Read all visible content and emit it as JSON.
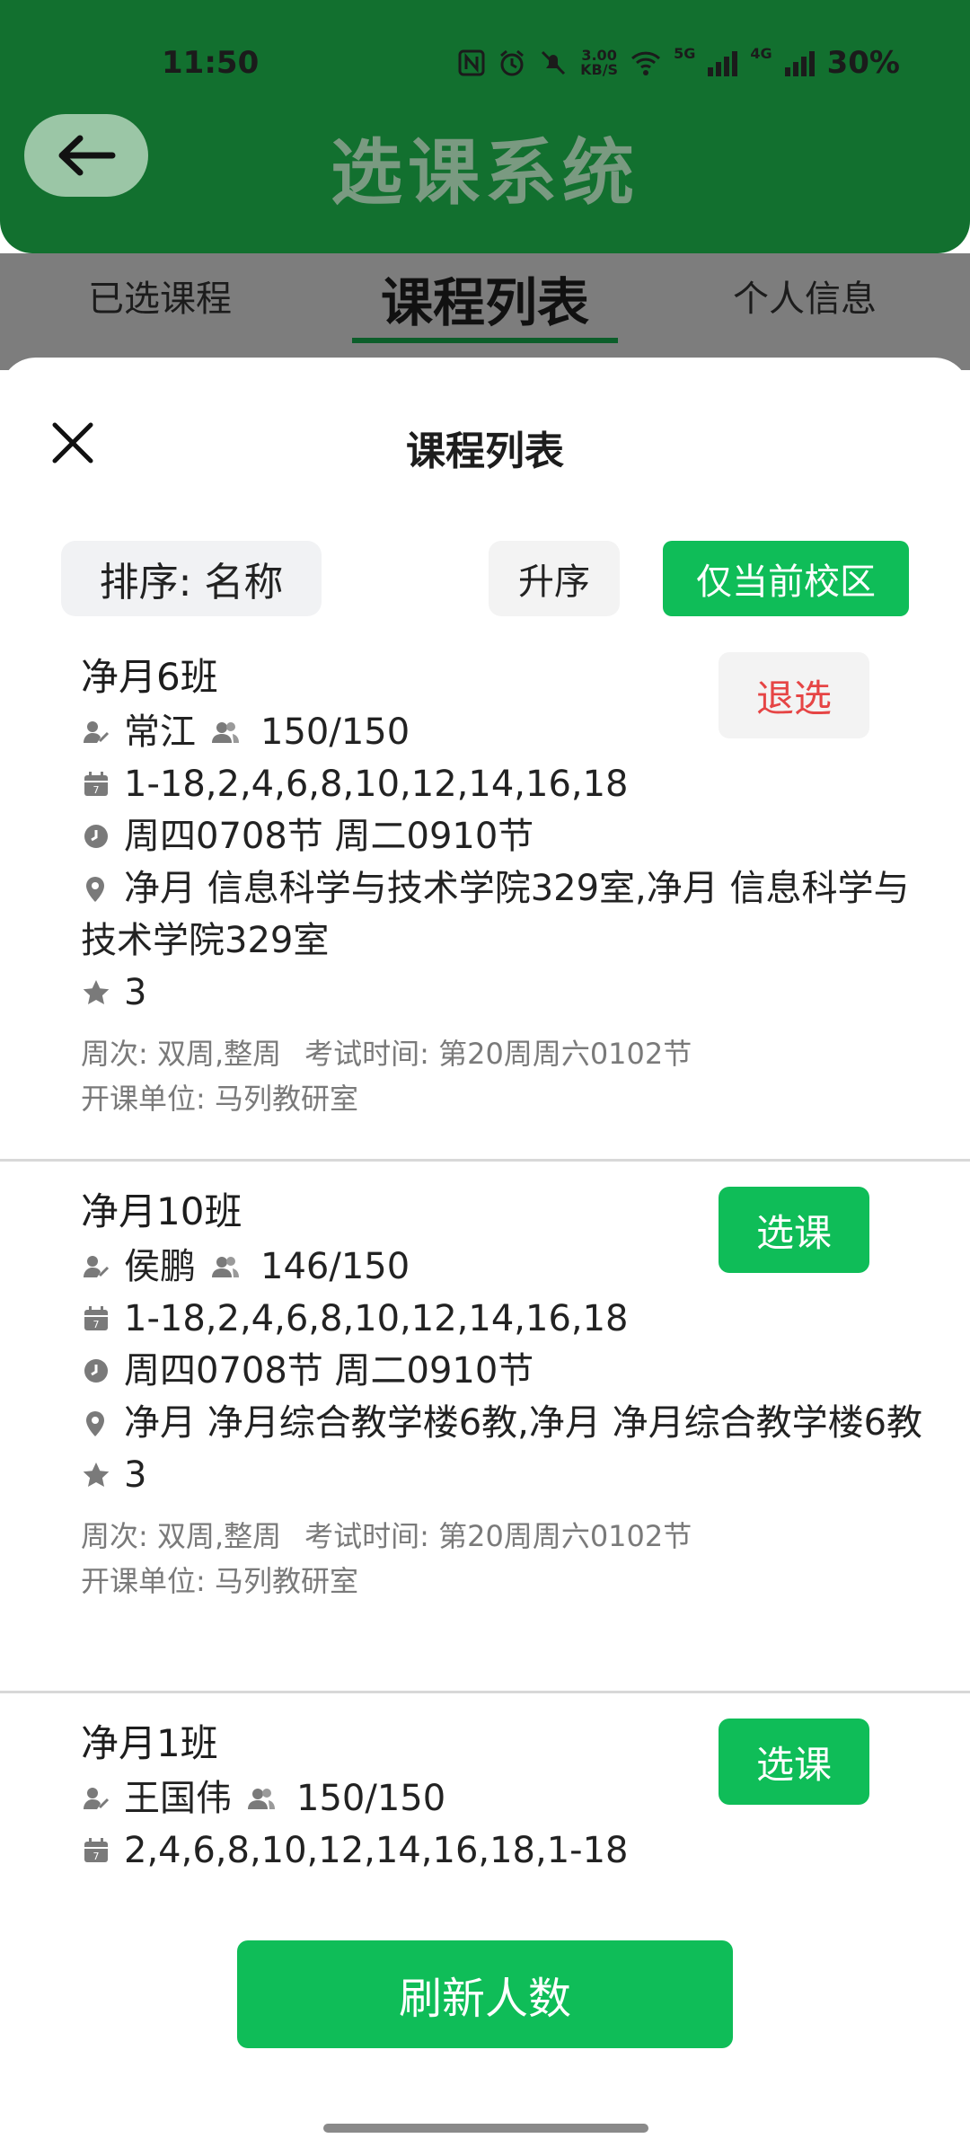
{
  "status_bar": {
    "time": "11:50",
    "net_speed_value": "3.00",
    "net_speed_unit": "KB/S",
    "sig1_tag": "5G",
    "sig2_tag": "4G",
    "battery": "30%",
    "icons": [
      "nfc-icon",
      "alarm-icon",
      "mute-icon",
      "wifi-icon",
      "cellular-5g-icon",
      "cellular-4g-icon"
    ]
  },
  "app": {
    "title": "选课系统"
  },
  "tabs": [
    {
      "label": "已选课程"
    },
    {
      "label": "课程列表"
    },
    {
      "label": "个人信息"
    }
  ],
  "sheet": {
    "title": "课程列表",
    "sort_label": "排序: 名称",
    "order_label": "升序",
    "campus_filter_label": "仅当前校区",
    "refresh_label": "刷新人数"
  },
  "courses": [
    {
      "name": "净月6班",
      "teacher": "常江",
      "capacity": "150/150",
      "weeks": "1-18,2,4,6,8,10,12,14,16,18",
      "time": "周四0708节 周二0910节",
      "location": "净月 信息科学与技术学院329室,净月 信息科学与技术学院329室",
      "credits": "3",
      "week_type": "周次: 双周,整周",
      "exam_time": "考试时间: 第20周周六0102节",
      "department": "开课单位: 马列教研室",
      "action_label": "退选"
    },
    {
      "name": "净月10班",
      "teacher": "侯鹏",
      "capacity": "146/150",
      "weeks": "1-18,2,4,6,8,10,12,14,16,18",
      "time": "周四0708节 周二0910节",
      "location": "净月 净月综合教学楼6教,净月 净月综合教学楼6教",
      "credits": "3",
      "week_type": "周次: 双周,整周",
      "exam_time": "考试时间: 第20周周六0102节",
      "department": "开课单位: 马列教研室",
      "action_label": "选课"
    },
    {
      "name": "净月1班",
      "teacher": "王国伟",
      "capacity": "150/150",
      "weeks": "2,4,6,8,10,12,14,16,18,1-18",
      "action_label": "选课"
    }
  ],
  "colors": {
    "header_green": "#12702f",
    "accent_green": "#0fbd58",
    "drop_red": "#e64545"
  }
}
